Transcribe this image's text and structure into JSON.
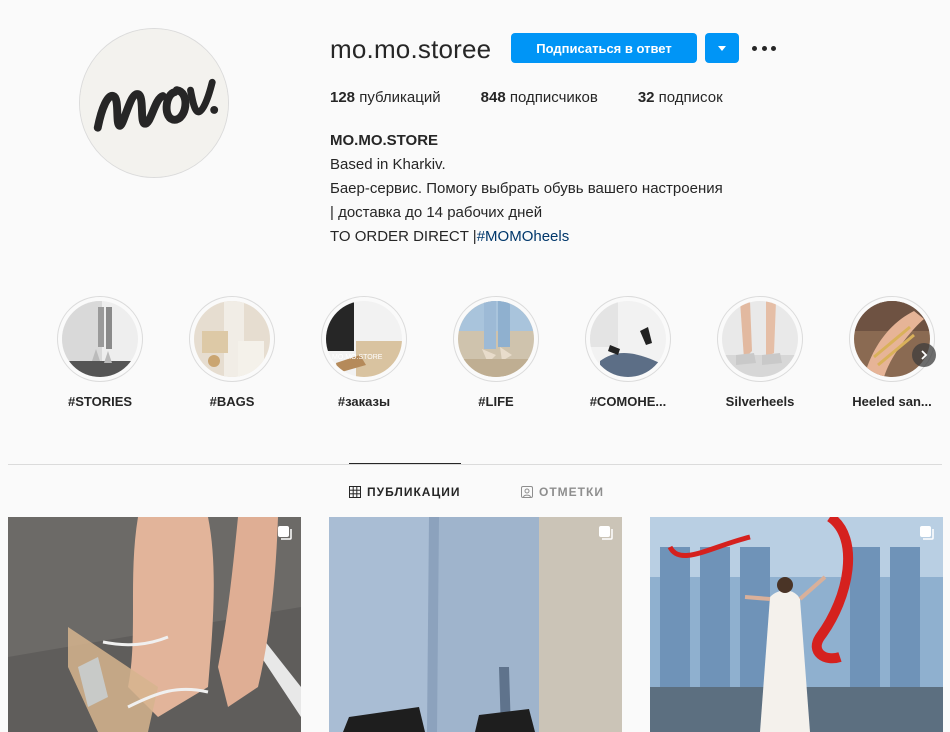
{
  "profile": {
    "username": "mo.mo.storee",
    "follow_back_label": "Подписаться в ответ",
    "avatar_icon": "avatar-logo",
    "stats": {
      "posts_count": "128",
      "posts_label": "публикаций",
      "followers_count": "848",
      "followers_label": "подписчиков",
      "following_count": "32",
      "following_label": "подписок"
    },
    "bio": {
      "name": "MO.MO.STORE",
      "line1": "Based in Kharkiv.",
      "line2": "Баер-сервис. Помогу выбрать обувь вашего настроения",
      "line3": "| доставка до 14 рабочих дней",
      "line4_prefix": "TO ORDER DIRECT |",
      "hashtag": "#MOMOheels"
    }
  },
  "highlights": [
    {
      "label": "#STORIES"
    },
    {
      "label": "#BAGS"
    },
    {
      "label": "#заказы"
    },
    {
      "label": "#LIFE"
    },
    {
      "label": "#COMOHE..."
    },
    {
      "label": "Silverheels"
    },
    {
      "label": "Heeled san..."
    }
  ],
  "tabs": {
    "posts_label": "ПУБЛИКАЦИИ",
    "tagged_label": "ОТМЕТКИ"
  },
  "colors": {
    "accent": "#0095f6",
    "background": "#fafafa",
    "text": "#262626",
    "hashtag": "#00376b",
    "muted": "#8e8e8e"
  }
}
